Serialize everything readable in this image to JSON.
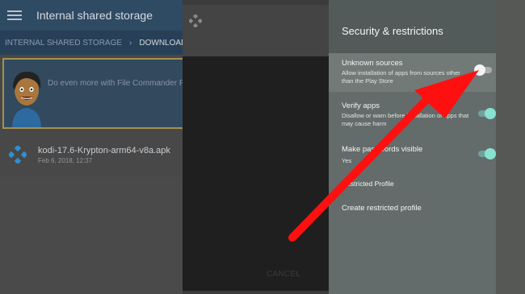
{
  "file_manager": {
    "title": "Internal shared storage",
    "breadcrumb": {
      "root": "INTERNAL SHARED STORAGE",
      "current": "DOWNLOAD"
    },
    "promo_text": "Do even more with File Commander Pre",
    "file": {
      "name": "kodi-17.6-Krypton-arm64-v8a.apk",
      "date": "Feb 6, 2018, 12:37"
    }
  },
  "dialog": {
    "cancel_label": "CANCEL"
  },
  "settings": {
    "title": "Security & restrictions",
    "unknown_sources": {
      "title": "Unknown sources",
      "line1": "Allow installation of apps from sources other",
      "line2": "than the Play Store",
      "enabled": false
    },
    "verify_apps": {
      "title": "Verify apps",
      "line1": "Disallow or warn before installation of apps that",
      "line2": "may cause harm",
      "enabled": true
    },
    "make_passwords_visible": {
      "title": "Make passwords visible",
      "value": "Yes",
      "enabled": true
    },
    "restricted_profile": {
      "title": "Restricted Profile"
    },
    "create_restricted_profile": {
      "title": "Create restricted profile"
    }
  },
  "colors": {
    "arrow": "#ff1010",
    "toggle_on": "#88e2d1"
  }
}
